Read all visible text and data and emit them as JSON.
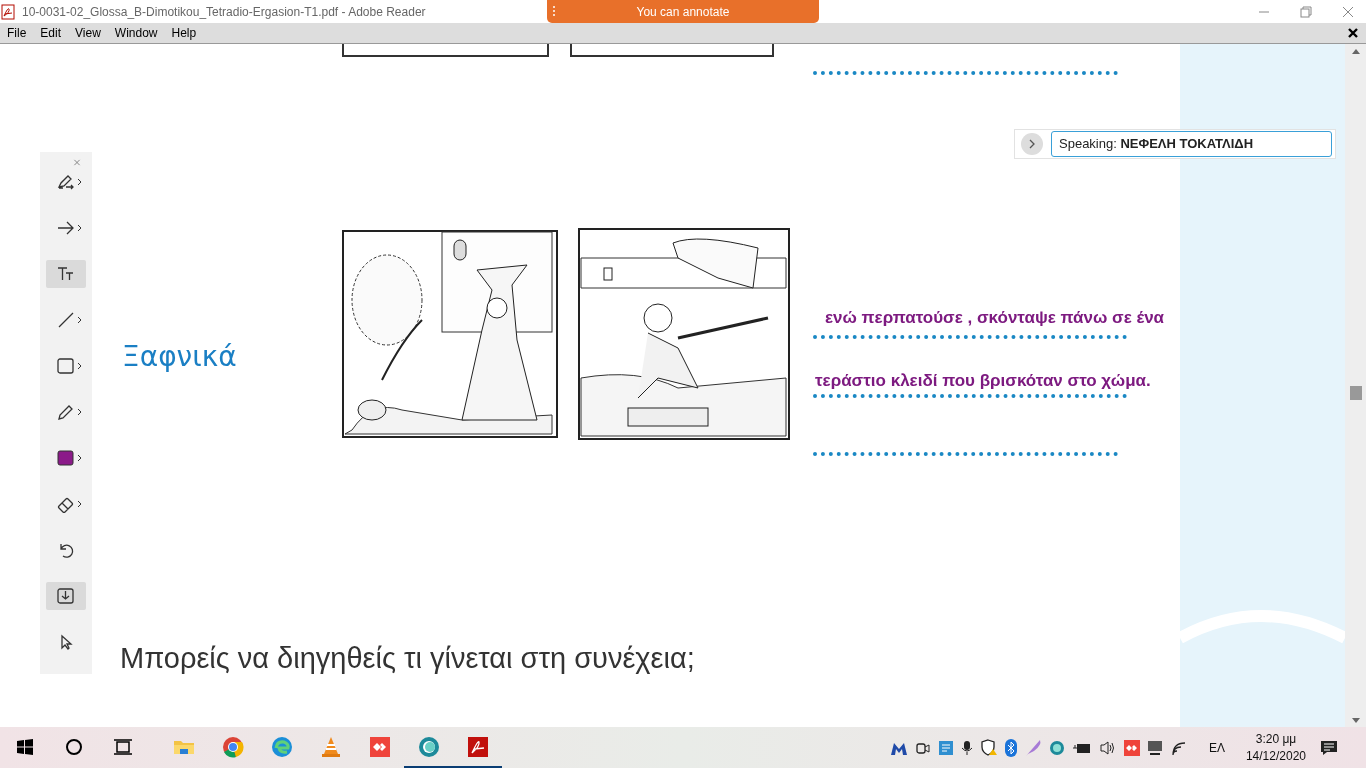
{
  "window": {
    "title": "10-0031-02_Glossa_B-Dimotikou_Tetradio-Ergasion-T1.pdf - Adobe Reader",
    "banner": "You can annotate"
  },
  "menu": [
    "File",
    "Edit",
    "View",
    "Window",
    "Help"
  ],
  "toolbar": {
    "tools": [
      {
        "kind": "highlight",
        "has_menu": true,
        "selected": false
      },
      {
        "kind": "arrow",
        "has_menu": true,
        "selected": false
      },
      {
        "kind": "text",
        "has_menu": false,
        "selected": true
      },
      {
        "kind": "line",
        "has_menu": true,
        "selected": false
      },
      {
        "kind": "rectangle",
        "has_menu": true,
        "selected": false
      },
      {
        "kind": "pencil",
        "has_menu": true,
        "selected": false
      },
      {
        "kind": "color",
        "has_menu": true,
        "selected": false,
        "color": "#8b1a89"
      },
      {
        "kind": "eraser",
        "has_menu": true,
        "selected": false
      },
      {
        "kind": "undo",
        "has_menu": false,
        "selected": false
      },
      {
        "kind": "save",
        "has_menu": false,
        "selected": true
      },
      {
        "kind": "select",
        "has_menu": false,
        "selected": false
      }
    ]
  },
  "speaking": {
    "text": "Speaking: **ΝΕΦΕΛΗ ΤΟΚΑΤΛΙΔΗ**"
  },
  "page": {
    "heading": "Ξαφνικά",
    "answers": [
      "ενώ περπατούσε , σκόνταψε πάνω σε ένα",
      "τεράστιο κλειδί που βρισκόταν στο χώμα."
    ],
    "prompt": "Μπορείς να διηγηθείς τι γίνεται στη συνέχεια;"
  },
  "taskbar": {
    "apps": [
      {
        "kind": "start",
        "running": false
      },
      {
        "kind": "search",
        "running": false
      },
      {
        "kind": "taskview",
        "running": false
      },
      {
        "kind": "folder",
        "running": false
      },
      {
        "kind": "chrome",
        "running": false
      },
      {
        "kind": "edge",
        "running": false
      },
      {
        "kind": "vlc",
        "running": false
      },
      {
        "kind": "anydesk",
        "running": false
      },
      {
        "kind": "ring",
        "running": true
      },
      {
        "kind": "acrobat",
        "running": true
      }
    ],
    "language": "ΕΛ",
    "time": "3:20 μμ",
    "date": "14/12/2020"
  }
}
